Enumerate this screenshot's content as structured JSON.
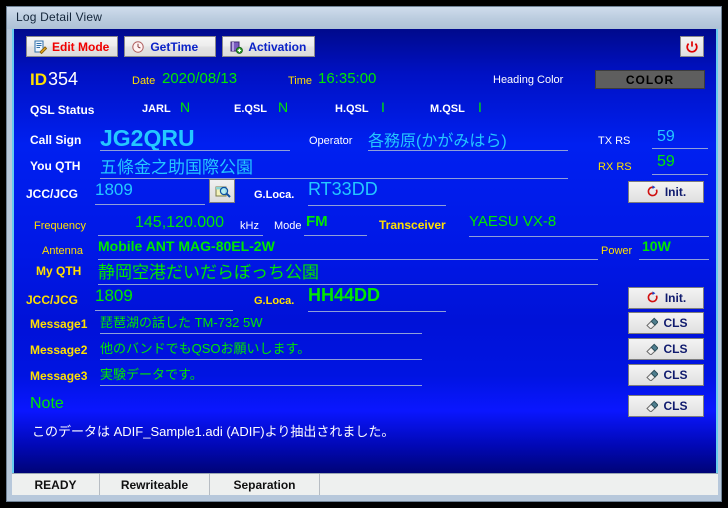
{
  "window": {
    "title": "Log Detail View"
  },
  "toolbar": {
    "edit_mode": "Edit Mode",
    "get_time": "GetTime",
    "activation": "Activation",
    "power_icon": "power-icon",
    "edit_icon": "edit-document-icon",
    "clock_icon": "clock-icon",
    "book_icon": "book-add-icon"
  },
  "header": {
    "id_label": "ID",
    "id_value": "354",
    "date_label": "Date",
    "date_value": "2020/08/13",
    "time_label": "Time",
    "time_value": "16:35:00",
    "heading_color_label": "Heading Color",
    "heading_color_button": "COLOR"
  },
  "qsl": {
    "title": "QSL Status",
    "items": [
      {
        "label": "JARL",
        "value": "N"
      },
      {
        "label": "E.QSL",
        "value": "N"
      },
      {
        "label": "H.QSL",
        "value": "I"
      },
      {
        "label": "M.QSL",
        "value": "I"
      }
    ]
  },
  "station": {
    "call_sign_label": "Call Sign",
    "call_sign_value": "JG2QRU",
    "operator_label": "Operator",
    "operator_value": "各務原(かがみはら)",
    "you_qth_label": "You QTH",
    "you_qth_value": "五條金之助国際公園",
    "jcc_label": "JCC/JCG",
    "jcc_value": "1809",
    "gloca_label": "G.Loca.",
    "gloca_value": "RT33DD",
    "search_icon": "magnifier-icon",
    "tx_rs_label": "TX RS",
    "tx_rs_value": "59",
    "rx_rs_label": "RX RS",
    "rx_rs_value": "59",
    "init_label": "Init.",
    "init_icon": "refresh-icon"
  },
  "radio": {
    "frequency_label": "Frequency",
    "frequency_value": "145,120.000",
    "frequency_unit": "kHz",
    "mode_label": "Mode",
    "mode_value": "FM",
    "transceiver_label": "Transceiver",
    "transceiver_value": "YAESU VX-8",
    "antenna_label": "Antenna",
    "antenna_value": "Mobile ANT MAG-80EL-2W",
    "power_label": "Power",
    "power_value": "10W"
  },
  "mystation": {
    "my_qth_label": "My QTH",
    "my_qth_value": "静岡空港だいだらぼっち公園",
    "jcc_label": "JCC/JCG",
    "jcc_value": "1809",
    "gloca_label": "G.Loca.",
    "gloca_value": "HH44DD",
    "init_label": "Init.",
    "init_icon": "refresh-icon"
  },
  "messages": [
    {
      "label": "Message1",
      "value": "琵琶湖の話した TM-732 5W",
      "button": "CLS"
    },
    {
      "label": "Message2",
      "value": "他のバンドでもQSOお願いします。",
      "button": "CLS"
    },
    {
      "label": "Message3",
      "value": "実験データです。",
      "button": "CLS"
    }
  ],
  "note": {
    "title": "Note",
    "text": "このデータは ADIF_Sample1.adi (ADIF)より抽出されました。",
    "button": "CLS",
    "button_icon": "eraser-icon"
  },
  "statusbar": {
    "cells": [
      "READY",
      "Rewriteable",
      "Separation",
      ""
    ]
  },
  "colors": {
    "label_white": "#ffffff",
    "label_yellow": "#ffe000",
    "value_green": "#00e800",
    "value_cyan": "#24c8ff",
    "accent_red": "#f00000",
    "accent_blue": "#0b23c8",
    "background_blue": "#0020f0",
    "background_navy": "#000477"
  }
}
